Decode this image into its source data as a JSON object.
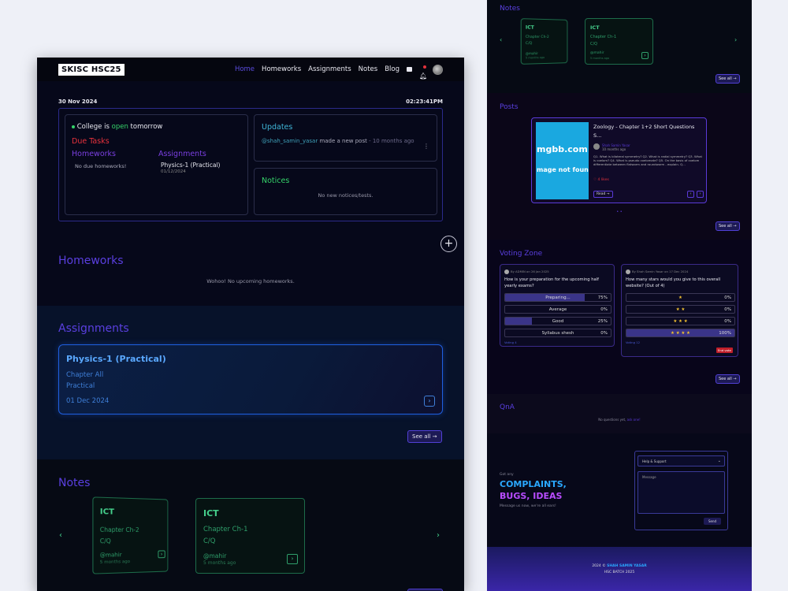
{
  "nav": {
    "logo": "SKISC HSC25",
    "links": [
      "Home",
      "Homeworks",
      "Assignments",
      "Notes",
      "Blog"
    ]
  },
  "dateline": {
    "date": "30 Nov 2024",
    "time": "02:23:41PM"
  },
  "status": {
    "prefix": "College is",
    "state": "open",
    "suffix": "tomorrow"
  },
  "due": {
    "title": "Due Tasks",
    "homeworks_label": "Homeworks",
    "homeworks_empty": "No due homeworks!",
    "assignments_label": "Assignments",
    "assignment_name": "Physics-1 (Practical)",
    "assignment_date": "01/12/2024"
  },
  "updates": {
    "title": "Updates",
    "user": "@shah_samin_yasar",
    "text": "made a new post",
    "time": "- 10 months ago"
  },
  "notices": {
    "title": "Notices",
    "empty": "No new notices/tests."
  },
  "homeworks": {
    "title": "Homeworks",
    "empty": "Wohoo! No upcoming homeworks."
  },
  "assignments": {
    "title": "Assignments",
    "card": {
      "name": "Physics-1 (Practical)",
      "chapter": "Chapter All",
      "type": "Practical",
      "date": "01 Dec 2024"
    },
    "see_all": "See all →"
  },
  "notes": {
    "title": "Notes",
    "cards": [
      {
        "subject": "ICT",
        "chapter": "Chapter Ch-2",
        "type": "C/Q",
        "author": "@mahir",
        "time": "5 months ago"
      },
      {
        "subject": "ICT",
        "chapter": "Chapter Ch-1",
        "type": "C/Q",
        "author": "@mahir",
        "time": "5 months ago"
      }
    ]
  },
  "right": {
    "notes_title": "Notes",
    "see_all": "See all →",
    "posts": {
      "title": "Posts",
      "image_text": "mgbb.com",
      "image_text2": "mage not found",
      "post_title": "Zoology - Chapter 1+2 Short Questions S...",
      "author": "Shah Samin Yasar",
      "time": "10 months ago",
      "excerpt": "Q1. What is bilateral symmetry? Q2. What is radial symmetry? Q3. What is coelom? Q4. What is pseudo coelomate? Q5. On the basis of coelom differentiate between flatworm and roundworm - explain. Q...",
      "likes": "4 likes",
      "read": "Read →"
    },
    "voting": {
      "title": "Voting Zone",
      "poll1": {
        "by": "By ADMIN on 26 Jan 2025",
        "question": "How is your preparation for the upcoming half yearly exams?",
        "options": [
          {
            "label": "Preparing...",
            "pct": "75%",
            "value": 75
          },
          {
            "label": "Average",
            "pct": "0%",
            "value": 0
          },
          {
            "label": "Good",
            "pct": "25%",
            "value": 25
          },
          {
            "label": "Syllabus shesh",
            "pct": "0%",
            "value": 0
          }
        ],
        "footer": "Voting 4"
      },
      "poll2": {
        "by": "By Shah Samin Yasar on 17 Dec 2024",
        "question": "How many stars would you give to this overall website? (Out of 4)",
        "options": [
          {
            "label": "★",
            "pct": "0%",
            "value": 0
          },
          {
            "label": "★ ★",
            "pct": "0%",
            "value": 0
          },
          {
            "label": "★ ★ ★",
            "pct": "0%",
            "value": 0
          },
          {
            "label": "★ ★ ★ ★",
            "pct": "100%",
            "value": 100
          }
        ],
        "footer": "Voting 12",
        "end_vote": "End vote"
      }
    },
    "qna": {
      "title": "QnA",
      "empty": "No questions yet,",
      "link": "ask one!"
    },
    "complaints": {
      "small": "Got any",
      "line1": "COMPLAINTS,",
      "line2": "BUGS, IDEAS",
      "note": "Message us now, we're all ears!",
      "select": "Help & Support",
      "message_placeholder": "Message",
      "send": "Send"
    },
    "footer": {
      "year": "2024 ©",
      "name": "SHAH SAMIN YASAR",
      "batch": "HSC BATCH 2025"
    }
  }
}
